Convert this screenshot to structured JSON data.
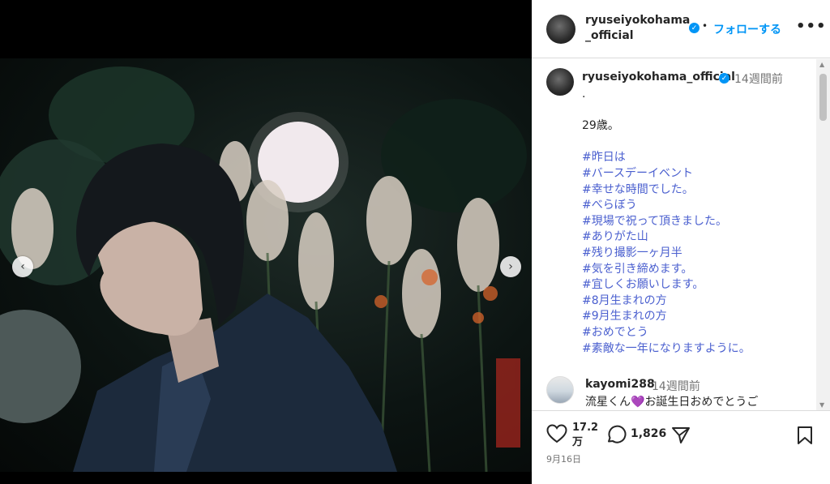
{
  "header": {
    "username": "ryuseiyokohama_official",
    "verified_mark": "✓",
    "separator": "•",
    "follow_label": "フォローする",
    "more_label": "•••"
  },
  "caption": {
    "username": "ryuseiyokohama_official",
    "verified_mark": "✓",
    "time": "14週間前",
    "lines": [
      ".",
      "",
      "29歳。",
      "",
      "#昨日は",
      "#バースデーイベント",
      "#幸せな時間でした。",
      "#べらぼう",
      "#現場で祝って頂きました。",
      "#ありがた山",
      "#残り撮影一ヶ月半",
      "#気を引き締めます。",
      "#宜しくお願いします。",
      "#8月生まれの方",
      "#9月生まれの方",
      "#おめでとう",
      "#素敵な一年になりますように。"
    ]
  },
  "comment": {
    "username": "kayomi288",
    "time": "14週間前",
    "text_before": "流星くん",
    "emoji": "💜",
    "text_after": "お誕生日おめでとうご"
  },
  "actions": {
    "likes": "17.2万",
    "likes_line1": "17.2",
    "likes_line2": "万",
    "comments": "1,826",
    "date": "9月16日"
  },
  "media": {
    "prev_arrow": "‹",
    "next_arrow": "›"
  },
  "icons": {
    "like": "heart-icon",
    "comment": "comment-bubble-icon",
    "share": "paper-plane-icon",
    "save": "bookmark-icon",
    "verified": "verified-badge-icon"
  },
  "colors": {
    "hashtag": "#4a5fcf",
    "follow": "#0095f6",
    "verified": "#0095f6",
    "muted_text": "#737373"
  }
}
